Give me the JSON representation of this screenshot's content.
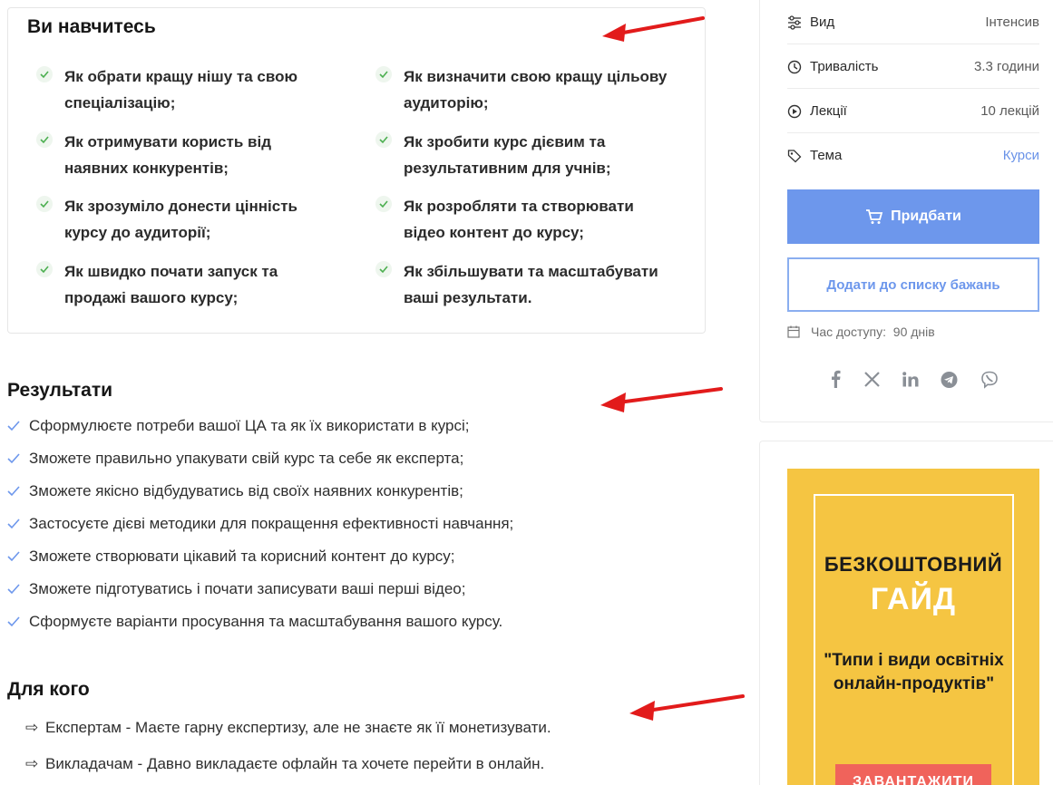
{
  "learn": {
    "title": "Ви навчитесь",
    "items": [
      "Як обрати кращу нішу та свою спеціалізацію;",
      "Як визначити свою кращу цільову аудиторію;",
      "Як отримувати користь від наявних конкурентів;",
      "Як зробити курс дієвим та результативним для учнів;",
      "Як зрозуміло донести цінність курсу до аудиторії;",
      "Як розробляти та створювати відео контент до курсу;",
      "Як швидко почати запуск та продажі вашого курсу;",
      "Як збільшувати та масштабувати ваші результати."
    ]
  },
  "results": {
    "title": "Результати",
    "items": [
      "Сформулюєте потреби вашої ЦА та як їх використати в курсі;",
      "Зможете правильно упакувати свій курс та себе як експерта;",
      "Зможете якісно відбудуватись від своїх наявних конкурентів;",
      "Застосуєте дієві методики для покращення ефективності навчання;",
      "Зможете створювати цікавий та корисний контент до курсу;",
      "Зможете підготуватись і почати записувати ваші перші відео;",
      "Сформуєте варіанти просування та масштабування вашого курсу."
    ]
  },
  "audience": {
    "title": "Для кого",
    "arrow_symbol": "⇨",
    "items": [
      "Експертам - Маєте гарну експертизу, але не знаєте як її монетизувати.",
      "Викладачам - Давно викладаєте офлайн та хочете перейти в онлайн."
    ]
  },
  "sidebar": {
    "meta": [
      {
        "label": "Вид",
        "value": "Інтенсив",
        "icon": "sliders-icon"
      },
      {
        "label": "Тривалість",
        "value": "3.3 години",
        "icon": "clock-icon"
      },
      {
        "label": "Лекції",
        "value": "10 лекцій",
        "icon": "play-circle-icon"
      },
      {
        "label": "Тема",
        "value": "Курси",
        "icon": "tag-icon"
      }
    ],
    "buy_label": "Придбати",
    "wishlist_label": "Додати до списку бажань",
    "access_label": "Час доступу:",
    "access_value": "90 днів",
    "share_icons": [
      "facebook-icon",
      "x-icon",
      "linkedin-icon",
      "telegram-icon",
      "viber-icon"
    ]
  },
  "ad": {
    "line1": "БЕЗКОШТОВНИЙ",
    "line2": "ГАЙД",
    "quote": "\"Типи і види освітніх онлайн-продуктів\"",
    "button": "ЗАВАНТАЖИТИ"
  },
  "colors": {
    "accent": "#6d97ec",
    "ad_bg": "#f5c542",
    "ad_button": "#f0635b",
    "annotation_arrow": "#e21b1b",
    "check_green": "#4caf50"
  }
}
